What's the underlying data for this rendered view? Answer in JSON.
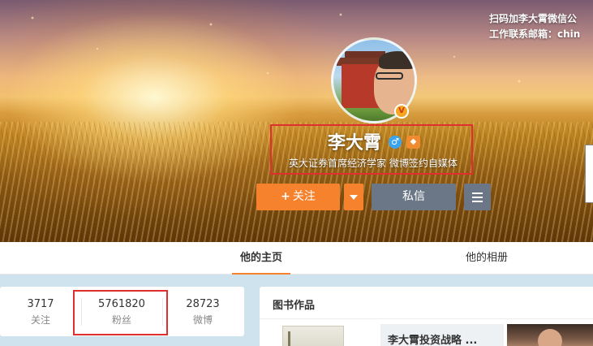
{
  "cover": {
    "note_lines": [
      "扫码加李大霄微信公",
      "工作联系邮箱：chin"
    ]
  },
  "profile": {
    "name": "李大霄",
    "description": "英大证券首席经济学家 微博签约自媒体",
    "gender_icon": "male-icon",
    "level_icon": "vip-level-icon"
  },
  "actions": {
    "follow_label": "关注",
    "follow_plus": "+",
    "message_label": "私信"
  },
  "tabs": [
    {
      "label": "他的主页",
      "active": true
    },
    {
      "label": "他的相册",
      "active": false
    }
  ],
  "stats": [
    {
      "value": "3717",
      "label": "关注"
    },
    {
      "value": "5761820",
      "label": "粉丝"
    },
    {
      "value": "28723",
      "label": "微博"
    }
  ],
  "books": {
    "title": "图书作品",
    "items": [
      {
        "title": "李大霄投资战略 ..."
      }
    ]
  },
  "colors": {
    "accent": "#f7822e",
    "secondary_button": "#6b7786",
    "highlight": "#e02f2f"
  }
}
